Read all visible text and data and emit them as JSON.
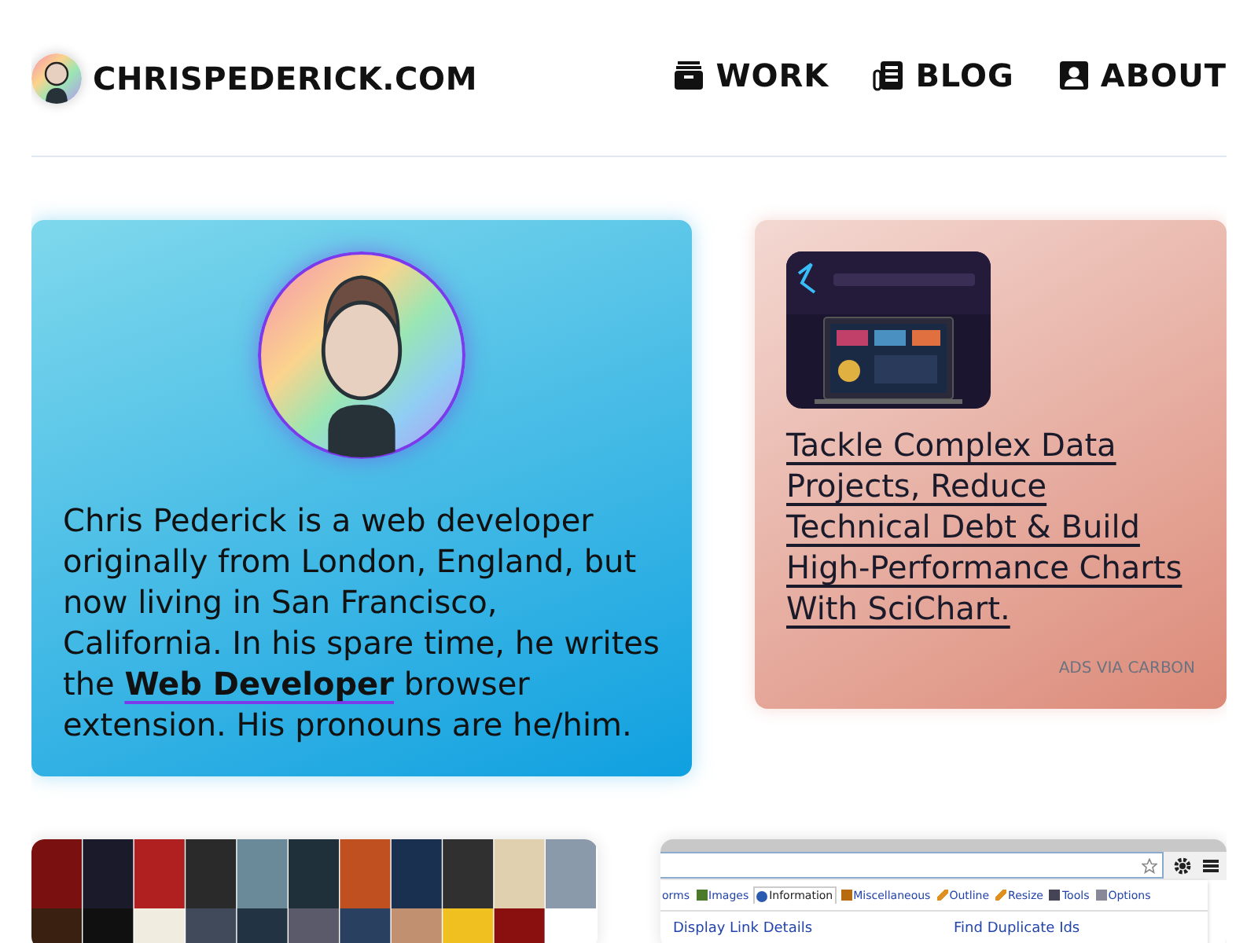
{
  "header": {
    "site_title": "CHRISPEDERICK.COM",
    "nav": [
      {
        "label": "WORK"
      },
      {
        "label": "BLOG"
      },
      {
        "label": "ABOUT"
      }
    ]
  },
  "bio": {
    "before": "Chris Pederick is a web developer originally from London, England, but now living in San Francisco, California. In his spare time, he writes the ",
    "link": "Web Developer",
    "after": " browser extension. His pronouns are he/him."
  },
  "ad": {
    "text": "Tackle Complex Data Projects, Reduce Technical Debt & Build High-Performance Charts With SciChart.",
    "credit": "ADS VIA CARBON"
  },
  "projects": [
    {
      "kind": "picture"
    },
    {
      "kind": "screenshot",
      "tabs": [
        {
          "label": "orms",
          "selected": false
        },
        {
          "label": "Images",
          "selected": false
        },
        {
          "label": "Information",
          "selected": true
        },
        {
          "label": "Miscellaneous",
          "selected": false
        },
        {
          "label": "Outline",
          "selected": false
        },
        {
          "label": "Resize",
          "selected": false
        },
        {
          "label": "Tools",
          "selected": false
        },
        {
          "label": "Options",
          "selected": false
        }
      ],
      "links": [
        "Display Link Details",
        "Find Duplicate Ids"
      ]
    }
  ]
}
